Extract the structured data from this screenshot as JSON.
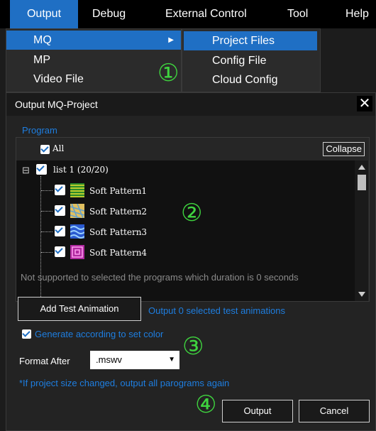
{
  "menubar": {
    "items": [
      "Output",
      "Debug",
      "External Control",
      "Tool",
      "Help"
    ]
  },
  "output_menu": {
    "items": [
      "MQ",
      "MP",
      "Video File"
    ],
    "submenu_arrow": "▶"
  },
  "mq_submenu": {
    "items": [
      "Project Files",
      "Config File",
      "Cloud Config"
    ]
  },
  "callouts": [
    "①",
    "②",
    "③",
    "④"
  ],
  "dialog": {
    "title": "Output MQ-Project",
    "close": "✕",
    "program_group_label": "Program",
    "all_label": "All",
    "collapse_button": "Collapse",
    "tree": {
      "expander": "⊟",
      "list_label": "list 1 (20/20)",
      "items": [
        "Soft Pattern1",
        "Soft Pattern2",
        "Soft Pattern3",
        "Soft Pattern4"
      ]
    },
    "note": "Not supported to selected the programs which duration is 0 seconds",
    "add_test_button": "Add Test Animation",
    "test_status": "Output 0 selected test animations",
    "generate_color_label": "Generate according to set color",
    "format_label": "Format After",
    "format_value": ".mswv",
    "format_caret": "▼",
    "warning": "*If project size changed, output all parograms again",
    "output_button": "Output",
    "cancel_button": "Cancel"
  }
}
